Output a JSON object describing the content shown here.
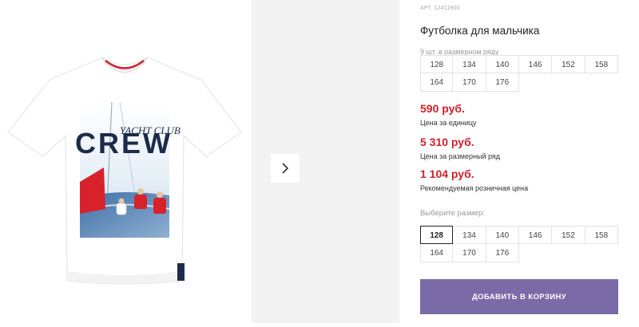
{
  "gallery": {
    "shirt_print": {
      "line1": "YACHT CLUB",
      "line2": "CREW"
    },
    "next_icon": "chevron-right-icon"
  },
  "product": {
    "article": "АРТ. 12411900",
    "title": "Футболка для мальчика",
    "pack_note": "9 шт. в размерном ряду",
    "pack_sizes": [
      "128",
      "134",
      "140",
      "146",
      "152",
      "158",
      "164",
      "170",
      "176"
    ],
    "unit_price": "590 руб.",
    "unit_price_note": "Цена за единицу",
    "pack_price": "5 310 руб.",
    "pack_price_note": "Цена за размерный ряд",
    "retail_price": "1 104 руб.",
    "retail_price_note": "Рекомендуемая розничная цена",
    "choose_size_label": "Выберите размер:",
    "selectable_sizes": [
      "128",
      "134",
      "140",
      "146",
      "152",
      "158",
      "164",
      "170",
      "176"
    ],
    "selected_size": "128",
    "cart_button": "ДОБАВИТЬ В КОРЗИНУ"
  },
  "colors": {
    "price_red": "#d0202a",
    "cart_purple": "#7b6aa8",
    "print_navy": "#1c2b4a"
  }
}
